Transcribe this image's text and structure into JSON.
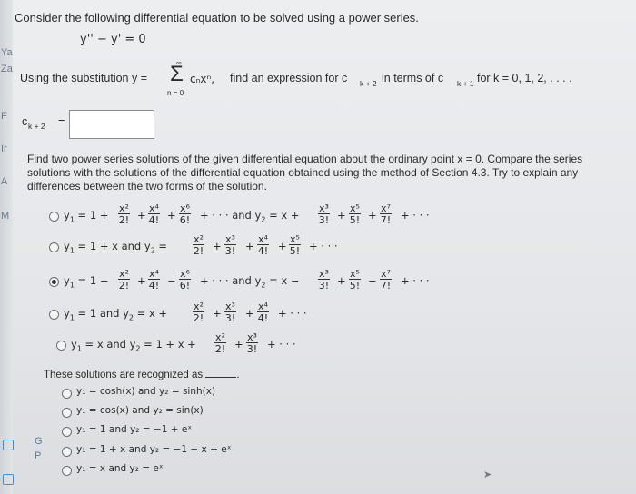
{
  "question1": {
    "title": "Consider the following differential equation to be solved using a power series.",
    "equation": "y'' − y' = 0",
    "sub_prefix": "Using the substitution  y =",
    "sum_top": "∞",
    "sum_sym": "Σ",
    "sum_bottom": "n = 0",
    "sum_term": "cₙxⁿ,",
    "sub_rest": "find an expression for  c",
    "sub_ck2": "k + 2",
    "sub_mid": "in terms of  c",
    "sub_ck1": "k + 1",
    "sub_end": "for  k = 0, 1, 2, . . . .",
    "answer_label": "c",
    "answer_sub": "k + 2",
    "answer_eq": "=",
    "answer_value": ""
  },
  "question2": {
    "intro_line1": "Find two power series solutions of the given differential equation about the ordinary point  x = 0. Compare the series",
    "intro_line2": "solutions with the solutions of the differential equation obtained using the method of Section 4.3. Try to explain any",
    "intro_line3": "differences between the two forms of the solution.",
    "options": [
      {
        "selected": false
      },
      {
        "selected": false
      },
      {
        "selected": true
      },
      {
        "selected": false
      },
      {
        "selected": false
      }
    ]
  },
  "question3": {
    "prompt": "These solutions are recognized as",
    "options": [
      {
        "label": "y₁ = cosh(x)   and   y₂ = sinh(x)",
        "selected": false
      },
      {
        "label": "y₁ = cos(x)   and   y₂ = sin(x)",
        "selected": false
      },
      {
        "label": "y₁ = 1   and   y₂ = −1 + eˣ",
        "selected": false
      },
      {
        "label": "y₁ = 1 + x   and   y₂ = −1 − x + eˣ",
        "selected": false
      },
      {
        "label": "y₁ = x   and   y₂ = eˣ",
        "selected": false
      }
    ]
  },
  "sidebar_fragments": [
    "Ya",
    "Za",
    "F",
    "Ir",
    "A",
    "M",
    "G",
    "P"
  ]
}
